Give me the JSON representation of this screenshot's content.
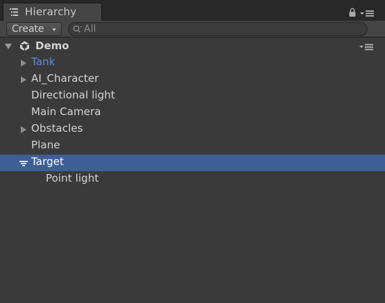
{
  "panel": {
    "tab_label": "Hierarchy",
    "create_label": "Create",
    "search_placeholder": "All",
    "search_value": ""
  },
  "scene": {
    "name": "Demo"
  },
  "items": [
    {
      "label": "Tank",
      "foldout": "collapsed",
      "style": "prefab"
    },
    {
      "label": "AI_Character",
      "foldout": "collapsed",
      "style": "normal"
    },
    {
      "label": "Directional light",
      "foldout": "none",
      "style": "normal"
    },
    {
      "label": "Main Camera",
      "foldout": "none",
      "style": "normal"
    },
    {
      "label": "Obstacles",
      "foldout": "collapsed",
      "style": "normal"
    },
    {
      "label": "Plane",
      "foldout": "none",
      "style": "normal"
    },
    {
      "label": "Target",
      "foldout": "expanded",
      "style": "selected"
    },
    {
      "label": "Point light",
      "foldout": "none",
      "style": "child"
    }
  ],
  "colors": {
    "selection": "#3e5f96",
    "prefab_text": "#5f8bd8",
    "background": "#3a3a3a"
  },
  "icons": {
    "tab": "hierarchy-list-icon",
    "lock": "lock-icon",
    "menu": "panel-menu-icon",
    "search": "search-icon",
    "scene": "unity-logo-icon"
  }
}
